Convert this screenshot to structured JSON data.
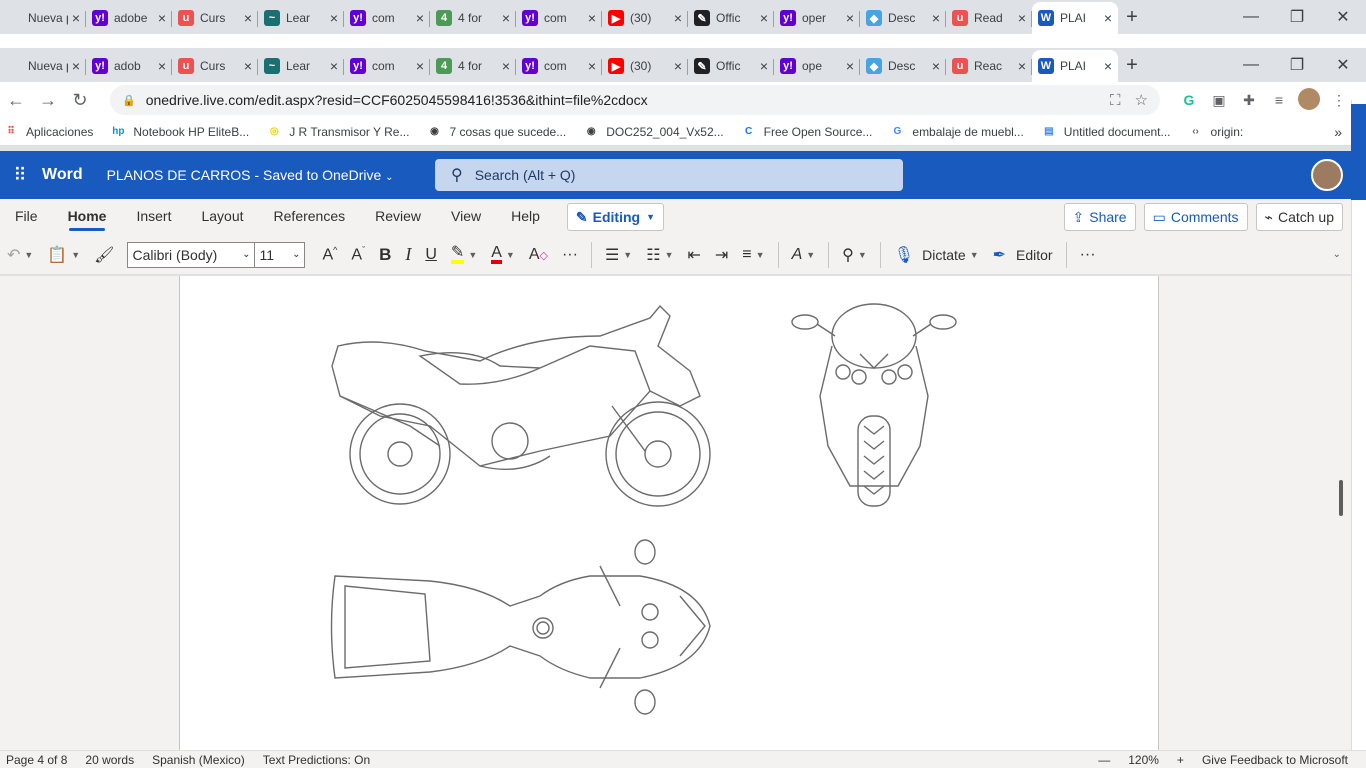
{
  "back_tabs": [
    {
      "title": "Nueva pes",
      "icon": "blank",
      "color": "#ffffff"
    },
    {
      "title": "adobe",
      "icon": "y!",
      "color": "#6001d2"
    },
    {
      "title": "Curs",
      "icon": "u",
      "color": "#ec5252"
    },
    {
      "title": "Lear",
      "icon": "~",
      "color": "#1a6f73"
    },
    {
      "title": "com",
      "icon": "y!",
      "color": "#6001d2"
    },
    {
      "title": "4 for",
      "icon": "4",
      "color": "#4d9a57"
    },
    {
      "title": "com",
      "icon": "y!",
      "color": "#6001d2"
    },
    {
      "title": "(30)",
      "icon": "▶",
      "color": "#ff0000"
    },
    {
      "title": "Offic",
      "icon": "✎",
      "color": "#202124"
    },
    {
      "title": "oper",
      "icon": "y!",
      "color": "#6001d2"
    },
    {
      "title": "Desc",
      "icon": "◆",
      "color": "#4aa3df"
    },
    {
      "title": "Read",
      "icon": "u",
      "color": "#ec5252"
    },
    {
      "title": "PLAI",
      "icon": "W",
      "color": "#185abd",
      "active": true
    }
  ],
  "front_tabs": [
    {
      "title": "Nueva pes",
      "icon": "blank",
      "color": "#ffffff"
    },
    {
      "title": "adob",
      "icon": "y!",
      "color": "#6001d2"
    },
    {
      "title": "Curs",
      "icon": "u",
      "color": "#ec5252"
    },
    {
      "title": "Lear",
      "icon": "~",
      "color": "#1a6f73"
    },
    {
      "title": "com",
      "icon": "y!",
      "color": "#6001d2"
    },
    {
      "title": "4 for",
      "icon": "4",
      "color": "#4d9a57"
    },
    {
      "title": "com",
      "icon": "y!",
      "color": "#6001d2"
    },
    {
      "title": "(30)",
      "icon": "▶",
      "color": "#ff0000"
    },
    {
      "title": "Offic",
      "icon": "✎",
      "color": "#202124"
    },
    {
      "title": "ope",
      "icon": "y!",
      "color": "#6001d2"
    },
    {
      "title": "Desc",
      "icon": "◆",
      "color": "#4aa3df"
    },
    {
      "title": "Reac",
      "icon": "u",
      "color": "#ec5252"
    },
    {
      "title": "PLAI",
      "icon": "W",
      "color": "#185abd",
      "active": true
    }
  ],
  "address": {
    "url": "onedrive.live.com/edit.aspx?resid=CCF6025045598416!3536&ithint=file%2cdocx"
  },
  "bookmarks": [
    {
      "label": "Aplicaciones",
      "icon": "apps-icon"
    },
    {
      "label": "Notebook HP EliteB...",
      "icon": "hp-icon"
    },
    {
      "label": "J R Transmisor Y Re...",
      "icon": "ml-icon"
    },
    {
      "label": "7 cosas que sucede...",
      "icon": "globe-icon"
    },
    {
      "label": "DOC252_004_Vx52...",
      "icon": "globe-icon"
    },
    {
      "label": "Free Open Source...",
      "icon": "c-icon"
    },
    {
      "label": "embalaje de muebl...",
      "icon": "google-icon"
    },
    {
      "label": "Untitled document...",
      "icon": "docs-icon"
    },
    {
      "label": "origin:",
      "icon": "code-icon"
    }
  ],
  "word": {
    "app_name": "Word",
    "doc_title": "PLANOS DE CARROS",
    "save_state": "Saved to OneDrive",
    "search_placeholder": "Search (Alt + Q)"
  },
  "menu": {
    "tabs": [
      "File",
      "Home",
      "Insert",
      "Layout",
      "References",
      "Review",
      "View",
      "Help"
    ],
    "active": "Home",
    "editing": "Editing",
    "share": "Share",
    "comments": "Comments",
    "catchup": "Catch up"
  },
  "toolbar": {
    "font": "Calibri (Body)",
    "size": "11",
    "dictate": "Dictate",
    "editor": "Editor"
  },
  "status": {
    "page": "Page 4 of 8",
    "words": "20 words",
    "language": "Spanish (Mexico)",
    "predictions": "Text Predictions: On",
    "zoom_minus": "—",
    "zoom": "120%",
    "zoom_plus": "+",
    "feedback": "Give Feedback to Microsoft"
  },
  "colors": {
    "word_blue": "#185abd",
    "highlight": "#ffff00",
    "font_color": "#e00000"
  }
}
